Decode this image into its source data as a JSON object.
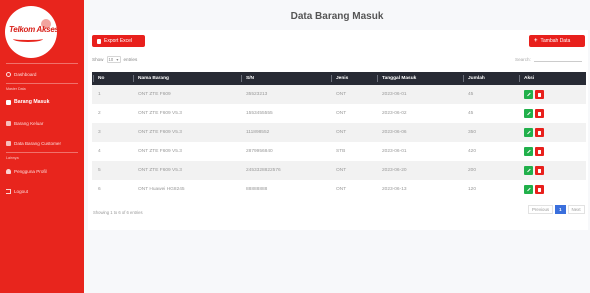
{
  "sidebar": {
    "logo_text": "Telkom Akses",
    "heading_master": "Master Data",
    "heading_other": "Lainnya",
    "items": [
      {
        "label": "Dashboard",
        "icon": "dashboard-icon"
      },
      {
        "label": "Barang Masuk",
        "icon": "box-icon",
        "active": true
      },
      {
        "label": "Barang Keluar",
        "icon": "box-out-icon"
      },
      {
        "label": "Data Barang Customer",
        "icon": "data-icon"
      },
      {
        "label": "Pengguna Profil",
        "icon": "user-icon"
      },
      {
        "label": "Logout",
        "icon": "logout-icon"
      }
    ]
  },
  "header": {
    "title": "Data Barang Masuk"
  },
  "toolbar": {
    "export_label": "Export Excel",
    "add_label": "Tambah Data"
  },
  "controls": {
    "show_label": "Show",
    "entries_value": "10",
    "entries_label": "entries",
    "search_label": "Search:",
    "search_value": ""
  },
  "table": {
    "columns": [
      "No",
      "Nama Barang",
      "S/N",
      "Jenis",
      "Tanggal Masuk",
      "Jumlah",
      "Aksi"
    ],
    "rows": [
      {
        "no": "1",
        "nama": "ONT ZTE F609",
        "sn": "35523213",
        "jenis": "ONT",
        "tanggal": "2023-06-01",
        "jumlah": "45"
      },
      {
        "no": "2",
        "nama": "ONT ZTE F609 V5.3",
        "sn": "1553455555",
        "jenis": "ONT",
        "tanggal": "2023-06-02",
        "jumlah": "45"
      },
      {
        "no": "3",
        "nama": "ONT ZTE F609 V5.3",
        "sn": "111898552",
        "jenis": "ONT",
        "tanggal": "2023-06-06",
        "jumlah": "350"
      },
      {
        "no": "4",
        "nama": "ONT ZTE F609 V5.3",
        "sn": "2879956840",
        "jenis": "STB",
        "tanggal": "2023-06-01",
        "jumlah": "420"
      },
      {
        "no": "5",
        "nama": "ONT ZTE F609 V5.3",
        "sn": "2453328822576",
        "jenis": "ONT",
        "tanggal": "2023-06-20",
        "jumlah": "200"
      },
      {
        "no": "6",
        "nama": "ONT Huawei HG8245",
        "sn": "88888888",
        "jenis": "ONT",
        "tanggal": "2023-06-13",
        "jumlah": "120"
      }
    ]
  },
  "footer": {
    "info": "Showing 1 to 6 of 6 entries",
    "prev_label": "Previous",
    "current_page": "1",
    "next_label": "Next"
  },
  "colors": {
    "brand_red": "#e8251d",
    "table_header": "#272a34",
    "edit_green": "#21b04b",
    "pager_blue": "#3a6fdc"
  }
}
